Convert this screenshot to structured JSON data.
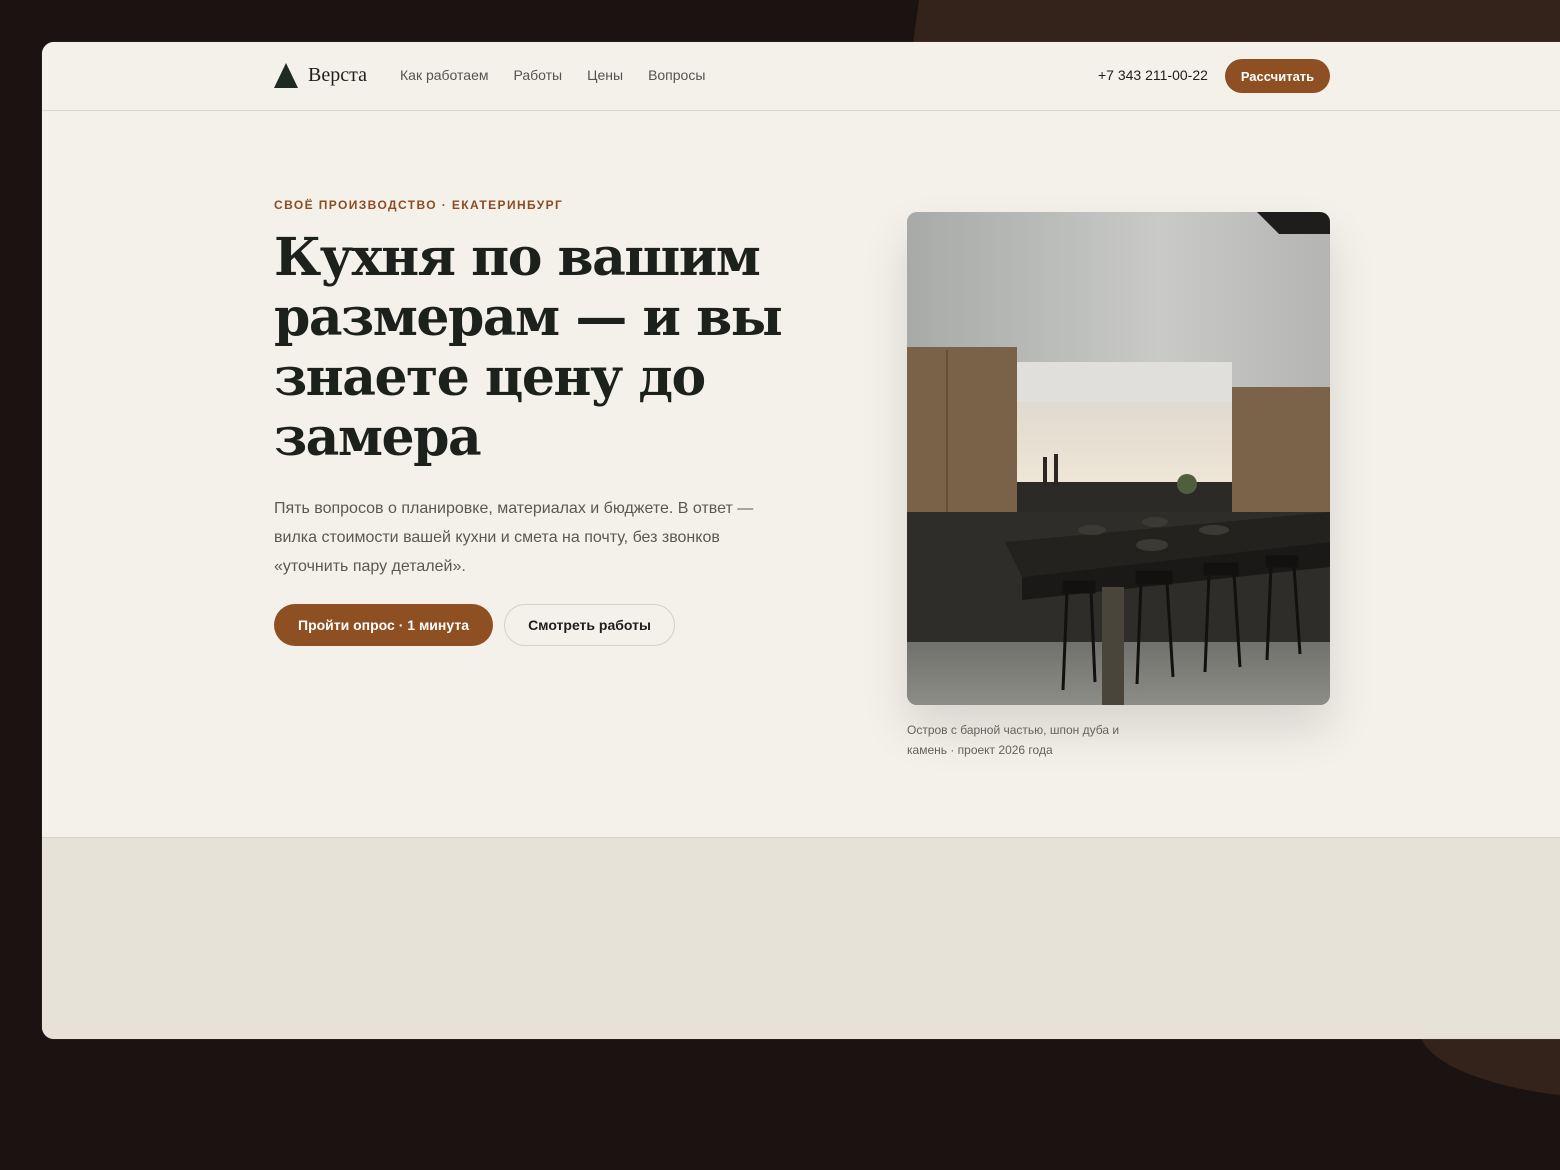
{
  "header": {
    "logo_text": "Верста",
    "nav": [
      {
        "label": "Как работаем"
      },
      {
        "label": "Работы"
      },
      {
        "label": "Цены"
      },
      {
        "label": "Вопросы"
      }
    ],
    "phone": "+7 343 211-00-22",
    "cta_label": "Рассчитать"
  },
  "hero": {
    "eyebrow": "СВОЁ ПРОИЗВОДСТВО · ЕКАТЕРИНБУРГ",
    "headline": "Кухня по вашим размерам — и вы знаете цену до замера",
    "lead": "Пять вопросов о планировке, материалах и бюджете. В ответ — вилка стоимости вашей кухни и смета на почту, без звонков «уточнить пару деталей».",
    "primary_cta": "Пройти опрос · 1 минута",
    "secondary_cta": "Смотреть работы"
  },
  "photo": {
    "caption": "Остров с барной частью, шпон дуба и камень · проект 2026 года"
  },
  "colors": {
    "accent": "#8e4f22",
    "background": "#f4f1ea",
    "page_backdrop": "#1b1311",
    "heading": "#1d211c"
  },
  "icons": {
    "logo": "triangle-logo-icon"
  }
}
